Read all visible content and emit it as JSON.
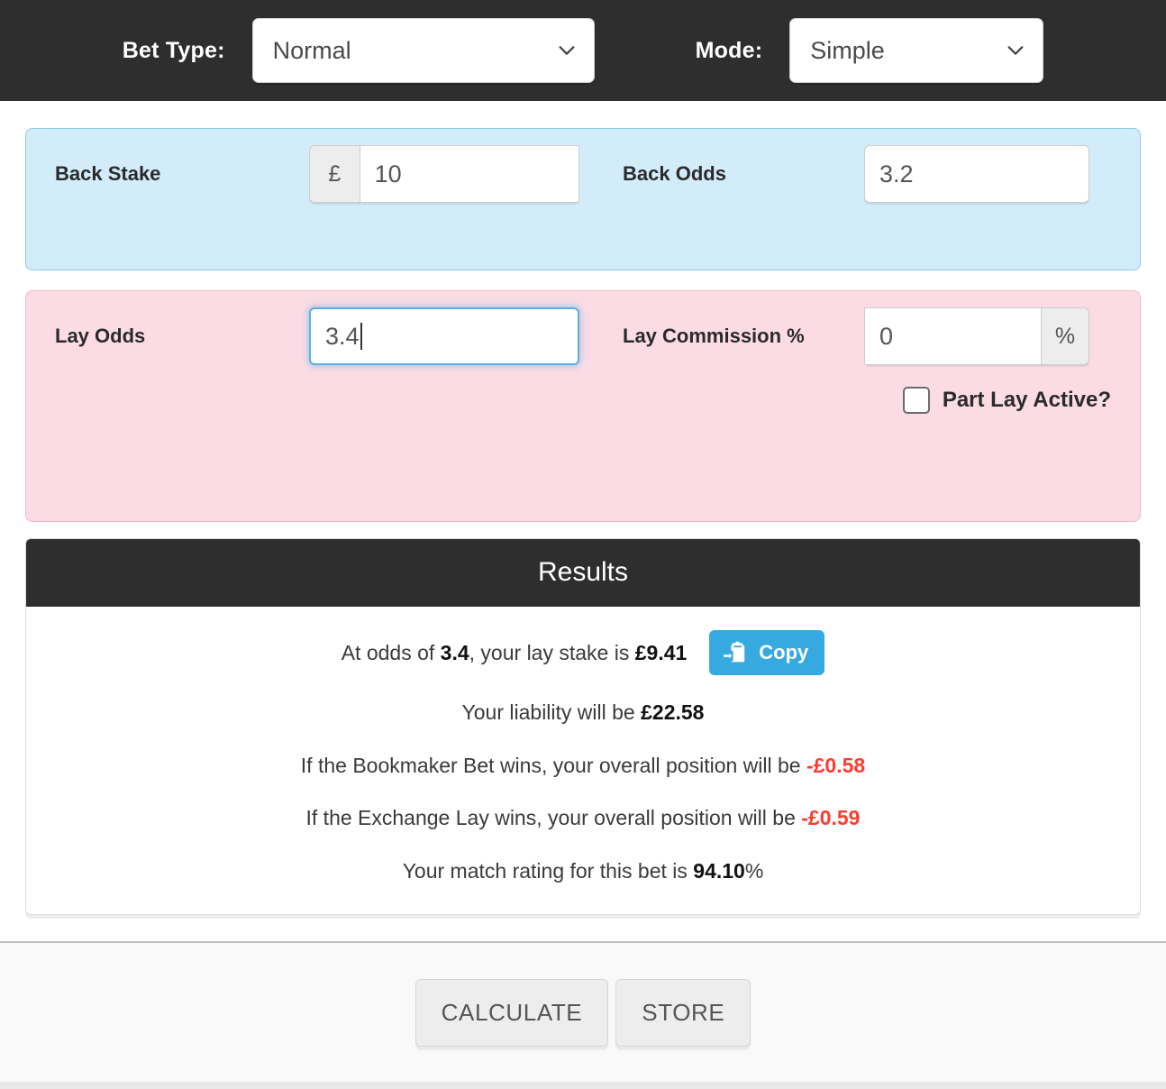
{
  "topbar": {
    "bet_type_label": "Bet Type:",
    "bet_type_value": "Normal",
    "mode_label": "Mode:",
    "mode_value": "Simple"
  },
  "back_section": {
    "back_stake_label": "Back Stake",
    "back_stake_currency": "£",
    "back_stake_value": "10",
    "back_odds_label": "Back Odds",
    "back_odds_value": "3.2",
    "bg_color": "#d3ecfa",
    "border_color": "#8ccaea"
  },
  "lay_section": {
    "lay_odds_label": "Lay Odds",
    "lay_odds_value": "3.4",
    "lay_commission_label": "Lay Commission %",
    "lay_commission_value": "0",
    "lay_commission_suffix": "%",
    "part_lay_label": "Part Lay Active?",
    "part_lay_checked": false,
    "bg_color": "#fbdce4",
    "border_color": "#f6b6c6"
  },
  "results": {
    "title": "Results",
    "stake_line": {
      "prefix": "At odds of ",
      "odds": "3.4",
      "middle": ", your lay stake is ",
      "stake": "£9.41"
    },
    "copy_label": "Copy",
    "liability": {
      "prefix": "Your liability will be ",
      "value": "£22.58"
    },
    "bookmaker": {
      "prefix": "If the Bookmaker Bet wins, your overall position will be ",
      "value": "-£0.58"
    },
    "exchange": {
      "prefix": "If the Exchange Lay wins, your overall position will be ",
      "value": "-£0.59"
    },
    "rating": {
      "prefix": "Your match rating for this bet is ",
      "value": "94.10",
      "suffix": "%"
    },
    "negative_color": "#ff3b30"
  },
  "footer": {
    "calculate_label": "CALCULATE",
    "store_label": "STORE"
  }
}
